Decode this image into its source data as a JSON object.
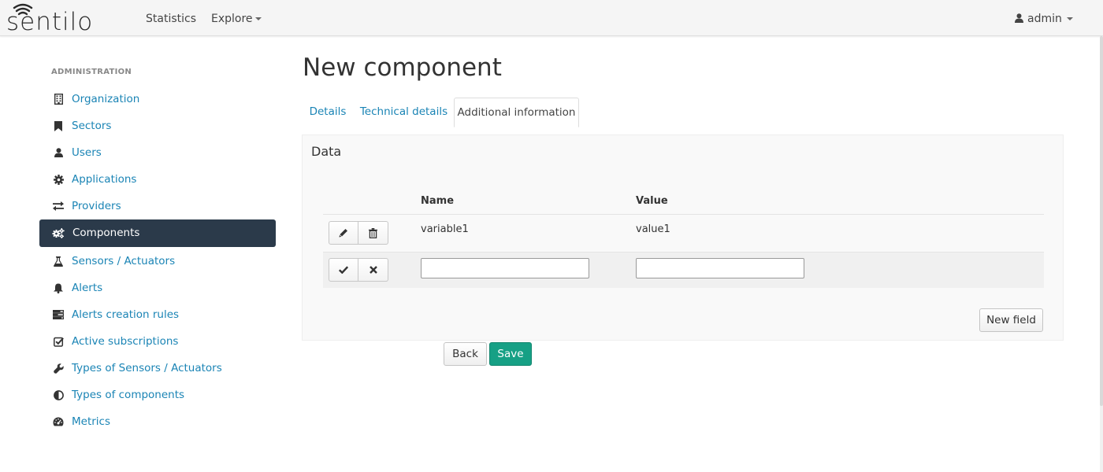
{
  "colors": {
    "accent": "#16a085",
    "link": "#1a84b5",
    "sidebar_active_bg": "#2b3a4a"
  },
  "brand": {
    "name": "sentilo"
  },
  "topnav": {
    "statistics": "Statistics",
    "explore": "Explore",
    "user": "admin"
  },
  "sidebar": {
    "header": "ADMINISTRATION",
    "items": [
      {
        "label": "Organization",
        "icon": "building-icon"
      },
      {
        "label": "Sectors",
        "icon": "bookmark-icon"
      },
      {
        "label": "Users",
        "icon": "user-icon"
      },
      {
        "label": "Applications",
        "icon": "gear-icon"
      },
      {
        "label": "Providers",
        "icon": "exchange-icon"
      },
      {
        "label": "Components",
        "icon": "gears-icon",
        "active": true
      },
      {
        "label": "Sensors / Actuators",
        "icon": "flask-icon"
      },
      {
        "label": "Alerts",
        "icon": "bell-icon"
      },
      {
        "label": "Alerts creation rules",
        "icon": "tasks-icon"
      },
      {
        "label": "Active subscriptions",
        "icon": "check-square-icon"
      },
      {
        "label": "Types of Sensors / Actuators",
        "icon": "wrench-icon"
      },
      {
        "label": "Types of components",
        "icon": "adjust-icon"
      },
      {
        "label": "Metrics",
        "icon": "dashboard-icon"
      }
    ]
  },
  "main": {
    "title": "New component",
    "tabs": [
      {
        "label": "Details"
      },
      {
        "label": "Technical details"
      },
      {
        "label": "Additional information",
        "active": true
      }
    ],
    "panel": {
      "title": "Data",
      "columns": {
        "name": "Name",
        "value": "Value"
      },
      "rows": [
        {
          "name": "variable1",
          "value": "value1"
        }
      ],
      "new_row": {
        "name_value": "",
        "value_value": ""
      },
      "new_field_label": "New field"
    },
    "buttons": {
      "back": "Back",
      "save": "Save"
    }
  }
}
